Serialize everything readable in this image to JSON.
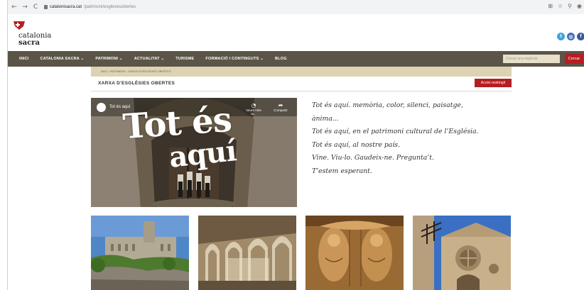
{
  "browser": {
    "back_icon": "←",
    "forward_icon": "→",
    "reload_icon": "C",
    "url_domain": "catalonisacra.cat",
    "url_path": "/patrimoni/esglesiesobertes",
    "icons": [
      "translate-icon",
      "star-icon",
      "extensions-icon",
      "profile-icon"
    ]
  },
  "header": {
    "logo_line1": "catalonia",
    "logo_line2": "sacra",
    "social": [
      {
        "name": "twitter-icon",
        "glyph": "t"
      },
      {
        "name": "instagram-icon",
        "glyph": "◎"
      },
      {
        "name": "facebook-icon",
        "glyph": "f"
      }
    ]
  },
  "nav": {
    "items": [
      "INICI",
      "CATALONIA SACRA ⌄",
      "PATRIMONI ⌄",
      "ACTUALITAT ⌄",
      "TURISME",
      "FORMACIÓ I CONTINGUTS ⌄",
      "BLOG"
    ],
    "search_placeholder": "Cercar una església",
    "search_button": "Cercar"
  },
  "page": {
    "breadcrumb": "INICI › PATRIMONI › XARXA D'ESGLÉSIES OBERTES",
    "title": "XARXA D'ESGLÉSIES OBERTES",
    "restricted_button": "Accés restringit"
  },
  "video": {
    "title": "Tot és aquí",
    "watch_later": "Veure més ta...",
    "share": "Compartir",
    "overlay_line1": "Tot és",
    "overlay_line2": "aquí"
  },
  "poem": [
    "Tot és aquí. memòria, color, silenci, paisatge,",
    "ànima...",
    "Tot és aquí, en el patrimoni cultural de l’Església.",
    "Tot és aquí, al nostre país.",
    "Vine. Viu-lo. Gaudeix-ne. Pregunta’t.",
    "T’estem esperant."
  ],
  "colors": {
    "nav_bg": "#5b5548",
    "accent_red": "#b51e22",
    "band": "#ddd3b3"
  }
}
